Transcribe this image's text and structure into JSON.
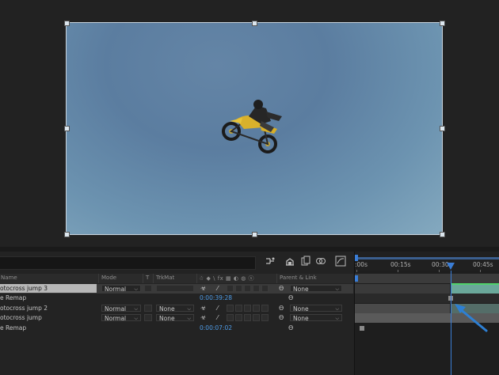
{
  "viewer": {
    "footage": "motocross-rider-mid-air"
  },
  "timeline": {
    "toolbar_icons": [
      "comp-flowchart-icon",
      "draft-3d-icon",
      "frame-blending-icon",
      "motion-blur-icon",
      "graph-editor-icon"
    ],
    "columns": {
      "name": "Name",
      "mode": "Mode",
      "t": "T",
      "trkmat": "TrkMat",
      "switches": "☃ ◆ \\ fx ▦ ◐ ◍ ⓢ",
      "parent": "Parent & Link"
    },
    "layers": [
      {
        "name": "otocross jump 3",
        "mode": "Normal",
        "trkmat": "",
        "parent": "None",
        "selected": true
      },
      {
        "name": "e Remap",
        "time": "0:00:39:28"
      },
      {
        "name": "otocross jump 2",
        "mode": "Normal",
        "trkmat": "None",
        "parent": "None"
      },
      {
        "name": "otocross jump",
        "mode": "Normal",
        "trkmat": "None",
        "parent": "None"
      },
      {
        "name": "e Remap",
        "time": "0:00:07:02"
      }
    ],
    "ruler": {
      "labels": [
        ":00s",
        "00:15s",
        "00:30s",
        "00:45s"
      ]
    },
    "colors": {
      "time_value": "#4e9be6",
      "cti": "#3a7dd6",
      "selected_bar": "#6aa89a",
      "annotation_arrow": "#2d7fd3"
    }
  }
}
